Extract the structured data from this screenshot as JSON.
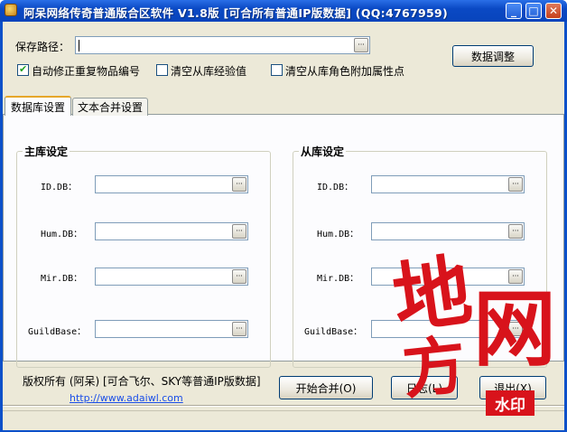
{
  "window": {
    "title": "阿呆网络传奇普通版合区软件 V1.8版 [可合所有普通IP版数据] (QQ:4767959)",
    "minimize_glyph": "_",
    "maximize_glyph": "□",
    "close_glyph": "✕"
  },
  "top": {
    "save_path_label": "保存路径：",
    "save_path_value": "",
    "browse_glyph": "···",
    "data_adjust_button": "数据调整",
    "options": [
      {
        "label": "自动修正重复物品编号",
        "checked": true
      },
      {
        "label": "清空从库经验值",
        "checked": false
      },
      {
        "label": "清空从库角色附加属性点",
        "checked": false
      }
    ]
  },
  "tabs": [
    {
      "label": "数据库设置",
      "active": true
    },
    {
      "label": "文本合并设置",
      "active": false
    }
  ],
  "master": {
    "title": "主库设定",
    "fields": [
      {
        "label": "ID.DB：",
        "value": ""
      },
      {
        "label": "Hum.DB：",
        "value": ""
      },
      {
        "label": "Mir.DB：",
        "value": ""
      },
      {
        "label": "GuildBase：",
        "value": ""
      }
    ]
  },
  "slave": {
    "title": "从库设定",
    "fields": [
      {
        "label": "ID.DB：",
        "value": ""
      },
      {
        "label": "Hum.DB：",
        "value": ""
      },
      {
        "label": "Mir.DB：",
        "value": ""
      },
      {
        "label": "GuildBase：",
        "value": ""
      }
    ]
  },
  "footer": {
    "copyright": "版权所有 (阿呆) [可合飞尔、SKY等普通IP版数据]",
    "url": "http://www.adaiwl.com",
    "start_button": "开始合并(O)",
    "help_button": "日志(L)",
    "exit_button": "退出(X)"
  },
  "watermark": {
    "chars": [
      "地",
      "网",
      "方"
    ],
    "seal": "水印"
  },
  "colors": {
    "titlebar": "#0a49c4",
    "client": "#ece9d8",
    "watermark": "#d8131b",
    "link": "#1a4ee8"
  }
}
